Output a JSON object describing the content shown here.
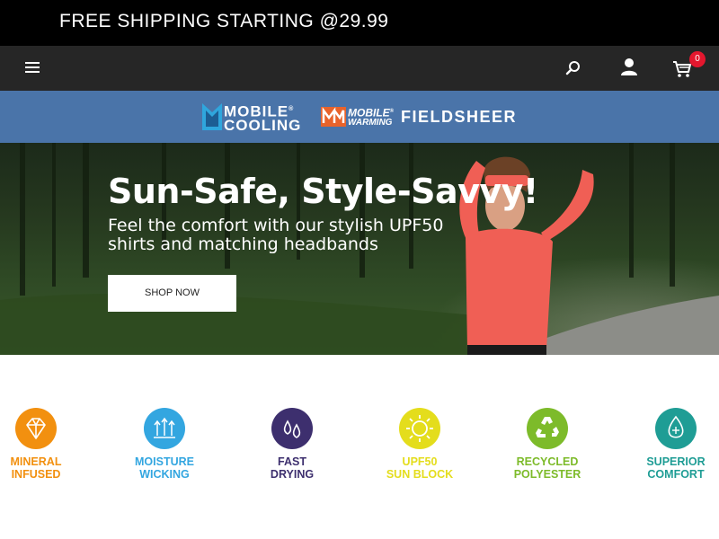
{
  "promo": {
    "text": "FREE SHIPPING STARTING @29.99"
  },
  "nav": {
    "menu_icon": "hamburger-menu-icon",
    "search_icon": "search-icon",
    "account_icon": "user-icon",
    "cart_icon": "cart-icon",
    "cart_count": "0"
  },
  "brands": {
    "mobile_cooling": {
      "line1": "MOBILE",
      "line2": "COOLING",
      "registered": "®"
    },
    "mobile_warming": {
      "line1": "MOBILE",
      "line2": "WARMING",
      "registered": "®"
    },
    "fieldsheer": {
      "name": "FIELDSHEER"
    }
  },
  "hero": {
    "title": "Sun-Safe, Style-Savvy!",
    "subtitle": "Feel the comfort with our stylish UPF50 shirts and matching headbands",
    "cta": "SHOP NOW"
  },
  "features": [
    {
      "label": "MINERAL\nINFUSED",
      "color": "#f2900f",
      "icon": "gem-icon"
    },
    {
      "label": "MOISTURE\nWICKING",
      "color": "#33a6e0",
      "icon": "wicking-arrows-icon"
    },
    {
      "label": "FAST\nDRYING",
      "color": "#3d2f6e",
      "icon": "water-drops-icon"
    },
    {
      "label": "UPF50\nSUN BLOCK",
      "color": "#e4dd1c",
      "icon": "sun-upf-icon"
    },
    {
      "label": "RECYCLED\nPOLYESTER",
      "color": "#7dbb2a",
      "icon": "recycle-icon"
    },
    {
      "label": "SUPERIOR\nCOMFORT",
      "color": "#1f9d95",
      "icon": "leaf-drop-icon"
    }
  ],
  "colors": {
    "promo_bg": "#000000",
    "nav_bg": "#262626",
    "brand_bar_bg": "#4a74a9",
    "cart_badge": "#e3172e"
  }
}
